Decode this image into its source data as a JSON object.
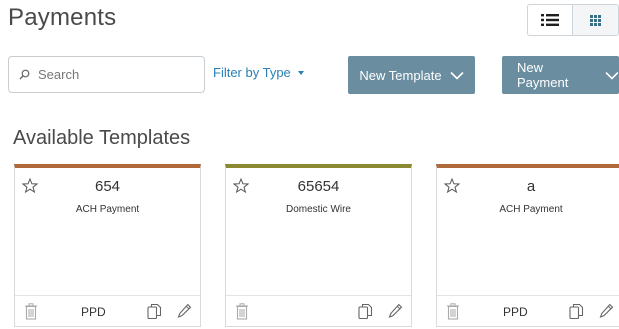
{
  "page": {
    "title": "Payments"
  },
  "view_toggle": {
    "list_icon": "list-icon",
    "grid_icon": "grid-icon",
    "active": "grid"
  },
  "search": {
    "placeholder": "Search",
    "value": "",
    "icon": "search-icon"
  },
  "filter": {
    "label": "Filter by Type",
    "icon": "caret-down-icon"
  },
  "buttons": {
    "new_template": "New Template",
    "new_payment": "New Payment",
    "chevron_icon": "chevron-down-icon",
    "color": "#6a8da0"
  },
  "section": {
    "title": "Available Templates"
  },
  "templates": [
    {
      "name": "654",
      "type": "ACH Payment",
      "sec_code": "PPD",
      "accent": "#b0693a"
    },
    {
      "name": "65654",
      "type": "Domestic Wire",
      "sec_code": "",
      "accent": "#8b8a33"
    },
    {
      "name": "a",
      "type": "ACH Payment",
      "sec_code": "PPD",
      "accent": "#b0693a"
    }
  ],
  "colors": {
    "link": "#2a7fb5",
    "text": "#333333",
    "heading": "#4a4a4a"
  }
}
